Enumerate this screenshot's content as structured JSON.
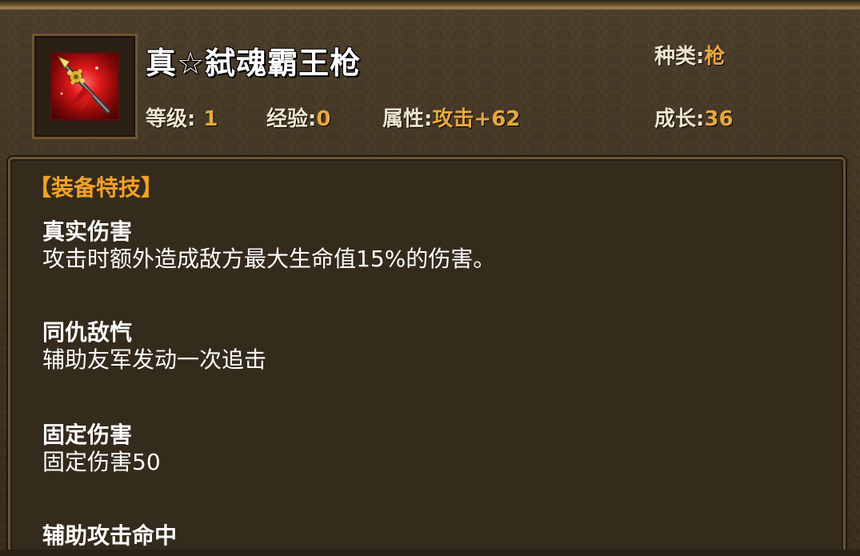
{
  "item": {
    "name": "真☆弑魂霸王枪",
    "icon": "spear-icon"
  },
  "stats": {
    "type_label": "种类:",
    "type_value": "枪",
    "level_label": "等级:",
    "level_value": "1",
    "exp_label": "经验:",
    "exp_value": "0",
    "attr_label": "属性:",
    "attr_value": "攻击+62",
    "growth_label": "成长:",
    "growth_value": "36"
  },
  "panel": {
    "section_title": "【装备特技】",
    "skills": [
      {
        "name": "真实伤害",
        "desc": "攻击时额外造成敌方最大生命值15%的伤害。"
      },
      {
        "name": "同仇敌忾",
        "desc": "辅助友军发动一次追击"
      },
      {
        "name": "固定伤害",
        "desc": "固定伤害50"
      },
      {
        "name": "辅助攻击命中",
        "desc": ""
      }
    ]
  },
  "colors": {
    "accent_gold": "#e7a841",
    "section_orange": "#f2a227",
    "panel_bg": "#342b1d",
    "frame_border": "#6a5331"
  }
}
